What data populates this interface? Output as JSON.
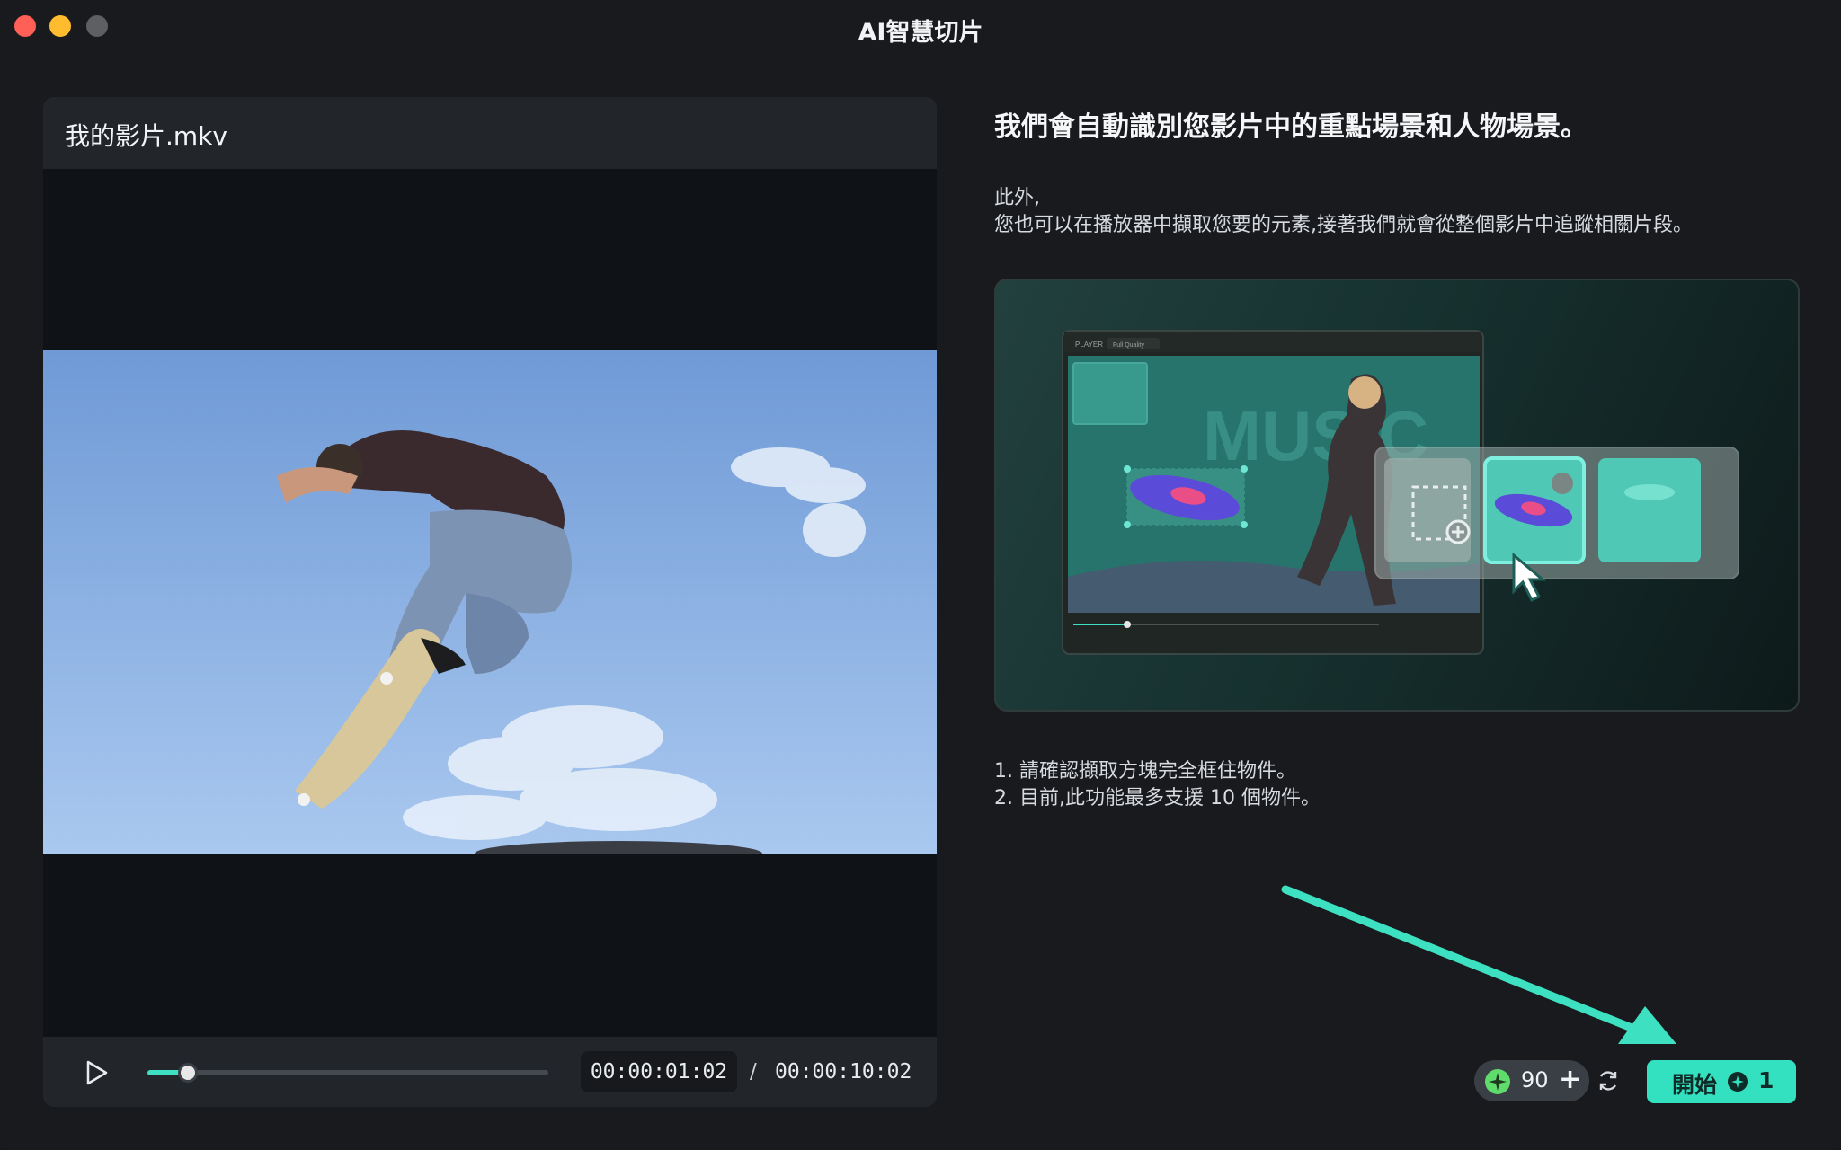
{
  "window": {
    "title": "AI智慧切片"
  },
  "player": {
    "filename": "我的影片.mkv",
    "current_time": "00:00:01:02",
    "separator": "/",
    "total_time": "00:00:10:02",
    "progress": 0.1
  },
  "info": {
    "headline": "我們會自動識別您影片中的重點場景和人物場景。",
    "description_line1": "此外,",
    "description_line2": "您也可以在播放器中擷取您要的元素,接著我們就會從整個影片中追蹤相關片段。",
    "note1": "1. 請確認擷取方塊完全框住物件。",
    "note2": "2. 目前,此功能最多支援 10 個物件。"
  },
  "demo": {
    "player_label": "PLAYER",
    "quality_label": "Full Quality",
    "background_text": "MUSIC"
  },
  "footer": {
    "credits": "90",
    "credits_add": "+",
    "start_label": "開始",
    "start_cost": "1"
  },
  "colors": {
    "accent": "#33e0c0",
    "credit_green": "#5fdc6c",
    "close": "#fe5f57",
    "minimize": "#febc2e"
  },
  "icons": [
    "play-icon",
    "refresh-icon",
    "credit-icon",
    "plus-icon",
    "trash-icon",
    "cursor-icon",
    "add-selection-icon"
  ]
}
